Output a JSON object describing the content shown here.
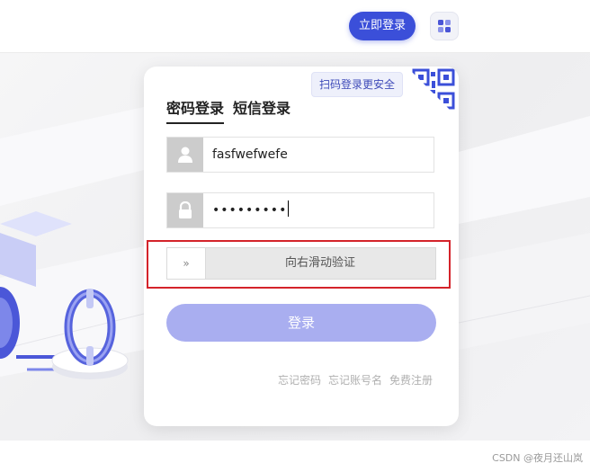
{
  "header": {
    "login_now_label": "立即登录",
    "app_icon": "app-grid-icon",
    "accent_color": "#3b4fd9"
  },
  "card": {
    "qr_tip": "扫码登录更安全",
    "qr_icon": "qr-code-icon",
    "tabs": [
      {
        "label": "密码登录",
        "active": true
      },
      {
        "label": "短信登录",
        "active": false
      }
    ],
    "username": {
      "icon": "user-icon",
      "value": "fasfwefwefe"
    },
    "password": {
      "icon": "lock-icon",
      "masked_value": "•••••••••"
    },
    "slider": {
      "handle_glyph": "»",
      "label": "向右滑动验证"
    },
    "submit_label": "登录",
    "links": [
      "忘记密码",
      "忘记账号名",
      "免费注册"
    ]
  },
  "watermark": "CSDN @夜月还山岚"
}
